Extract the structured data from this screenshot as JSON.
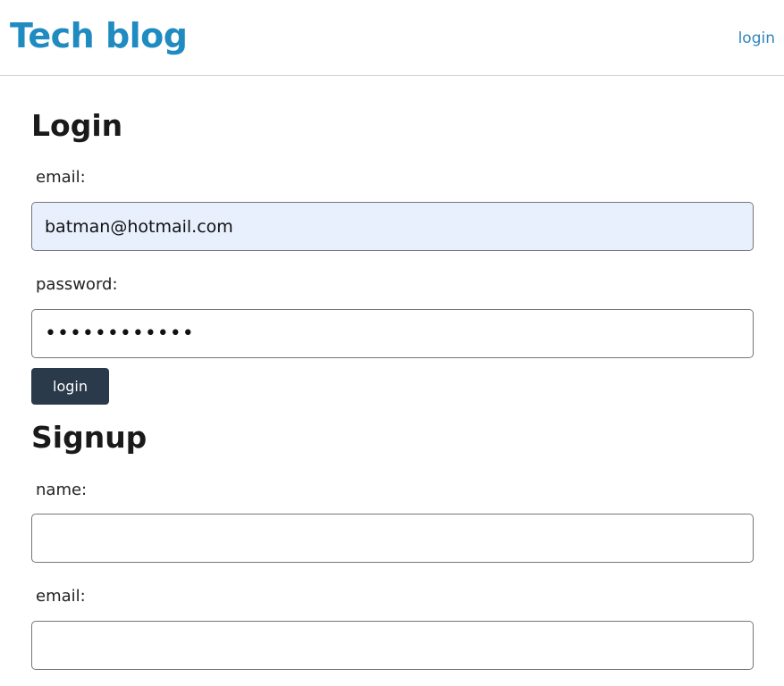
{
  "header": {
    "brand": "Tech blog",
    "nav_login": "login"
  },
  "login": {
    "title": "Login",
    "email_label": "email:",
    "email_value": "batman@hotmail.com",
    "password_label": "password:",
    "password_value": "••••••••••••",
    "button_label": "login"
  },
  "signup": {
    "title": "Signup",
    "name_label": "name:",
    "name_value": "",
    "email_label": "email:",
    "email_value": ""
  },
  "colors": {
    "brand": "#1f8bc0",
    "link": "#2f86c1",
    "button_bg": "#2b3a4b",
    "autofill_bg": "#e8f0fe"
  }
}
